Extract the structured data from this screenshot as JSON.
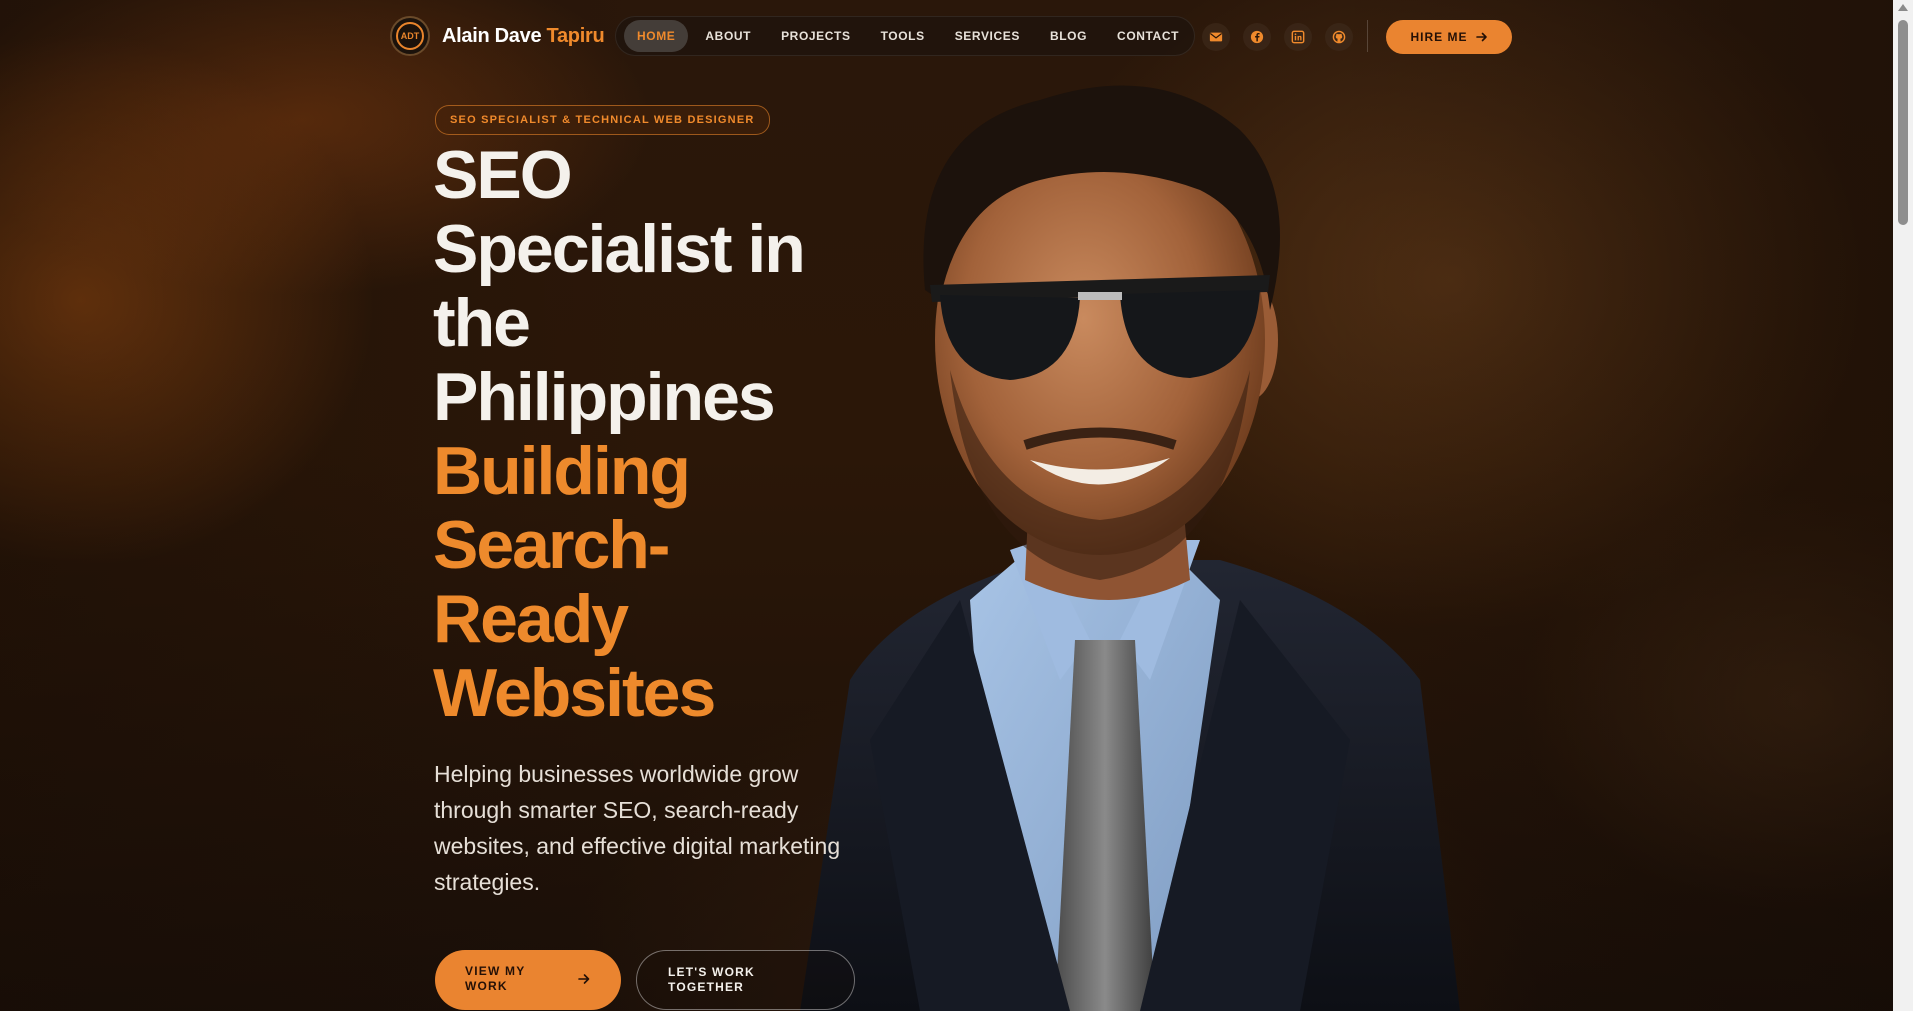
{
  "brand": {
    "logo_text": "ADT",
    "first_name": "Alain Dave",
    "last_name": "Tapiru"
  },
  "nav": {
    "items": [
      {
        "label": "HOME",
        "active": true
      },
      {
        "label": "ABOUT",
        "active": false
      },
      {
        "label": "PROJECTS",
        "active": false
      },
      {
        "label": "TOOLS",
        "active": false
      },
      {
        "label": "SERVICES",
        "active": false
      },
      {
        "label": "BLOG",
        "active": false
      },
      {
        "label": "CONTACT",
        "active": false
      }
    ],
    "social_icons": [
      "mail-icon",
      "facebook-icon",
      "linkedin-icon",
      "github-icon"
    ],
    "hire_label": "HIRE ME"
  },
  "hero": {
    "badge": "SEO SPECIALIST & TECHNICAL WEB DESIGNER",
    "headline_white": [
      "SEO",
      "Specialist in",
      "the",
      "Philippines"
    ],
    "headline_orange": [
      "Building",
      "Search-",
      "Ready",
      "Websites"
    ],
    "subtitle": "Helping businesses worldwide grow through smarter SEO, search-ready websites, and effective digital marketing strategies.",
    "cta_primary": "VIEW MY WORK",
    "cta_secondary": "LET'S WORK TOGETHER"
  },
  "colors": {
    "accent": "#ea8430",
    "background": "#1a0f07",
    "text": "#f4f1ec"
  }
}
